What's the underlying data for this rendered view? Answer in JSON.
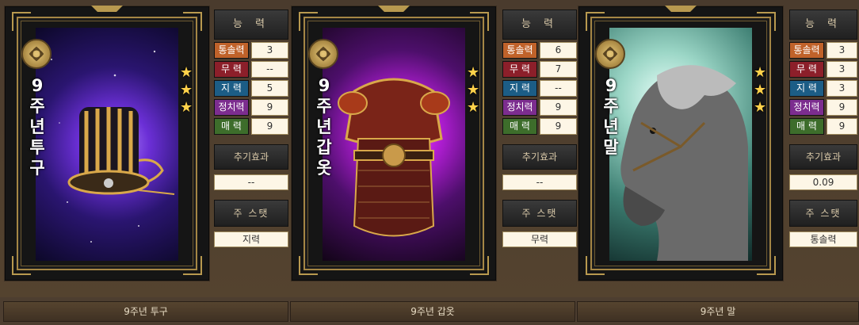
{
  "labels": {
    "ability_header": "능 력",
    "extra_effect": "추기효과",
    "main_stat": "주 스탯",
    "stat_names": [
      "통솔력",
      "무   력",
      "지   력",
      "정치력",
      "매   력"
    ]
  },
  "items": [
    {
      "title_vertical": "9주년 투구",
      "stars": [
        "★",
        "★",
        "★"
      ],
      "stats": [
        "3",
        "--",
        "5",
        "9",
        "9"
      ],
      "extra_effect_value": "--",
      "main_stat_value": "지력",
      "name": "9주년 투구"
    },
    {
      "title_vertical": "9주년 갑옷",
      "stars": [
        "★",
        "★",
        "★"
      ],
      "stats": [
        "6",
        "7",
        "--",
        "9",
        "9"
      ],
      "extra_effect_value": "--",
      "main_stat_value": "무력",
      "name": "9주년 갑옷"
    },
    {
      "title_vertical": "9주년 말",
      "stars": [
        "★",
        "★",
        "★"
      ],
      "stats": [
        "3",
        "3",
        "3",
        "9",
        "9"
      ],
      "extra_effect_value": "0.09",
      "main_stat_value": "통솔력",
      "name": "9주년 말"
    }
  ],
  "colors": {
    "stat_label_tong": "#c0622a",
    "stat_label_mu": "#8c1f2a",
    "stat_label_ji": "#1c5d86",
    "stat_label_jeong": "#7c2d8f",
    "stat_label_mae": "#3d6d2b",
    "star": "#ffd24a"
  },
  "icons": {
    "medal": "knot-medal-icon",
    "star": "star-icon"
  }
}
